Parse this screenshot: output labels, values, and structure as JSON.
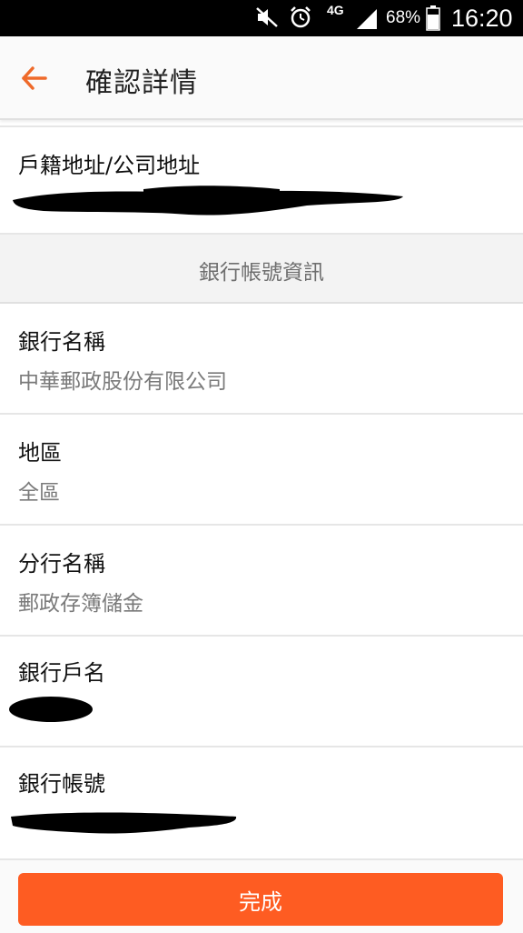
{
  "status_bar": {
    "network": "4G",
    "battery": "68%",
    "time": "16:20",
    "icons": [
      "mute-icon",
      "alarm-icon",
      "network-4g-icon",
      "signal-icon",
      "battery-icon"
    ]
  },
  "app_bar": {
    "back_icon": "arrow-left-icon",
    "title": "確認詳情",
    "accent_color": "#ef6a2a"
  },
  "address": {
    "label": "戶籍地址/公司地址",
    "value_redacted": true
  },
  "bank_section": {
    "header": "銀行帳號資訊",
    "fields": [
      {
        "label": "銀行名稱",
        "value": "中華郵政股份有限公司"
      },
      {
        "label": "地區",
        "value": "全區"
      },
      {
        "label": "分行名稱",
        "value": "郵政存簿儲金"
      },
      {
        "label": "銀行戶名",
        "value_redacted": true
      },
      {
        "label": "銀行帳號",
        "value_redacted": true
      }
    ]
  },
  "footer": {
    "done_label": "完成",
    "button_color": "#fe5c22"
  }
}
